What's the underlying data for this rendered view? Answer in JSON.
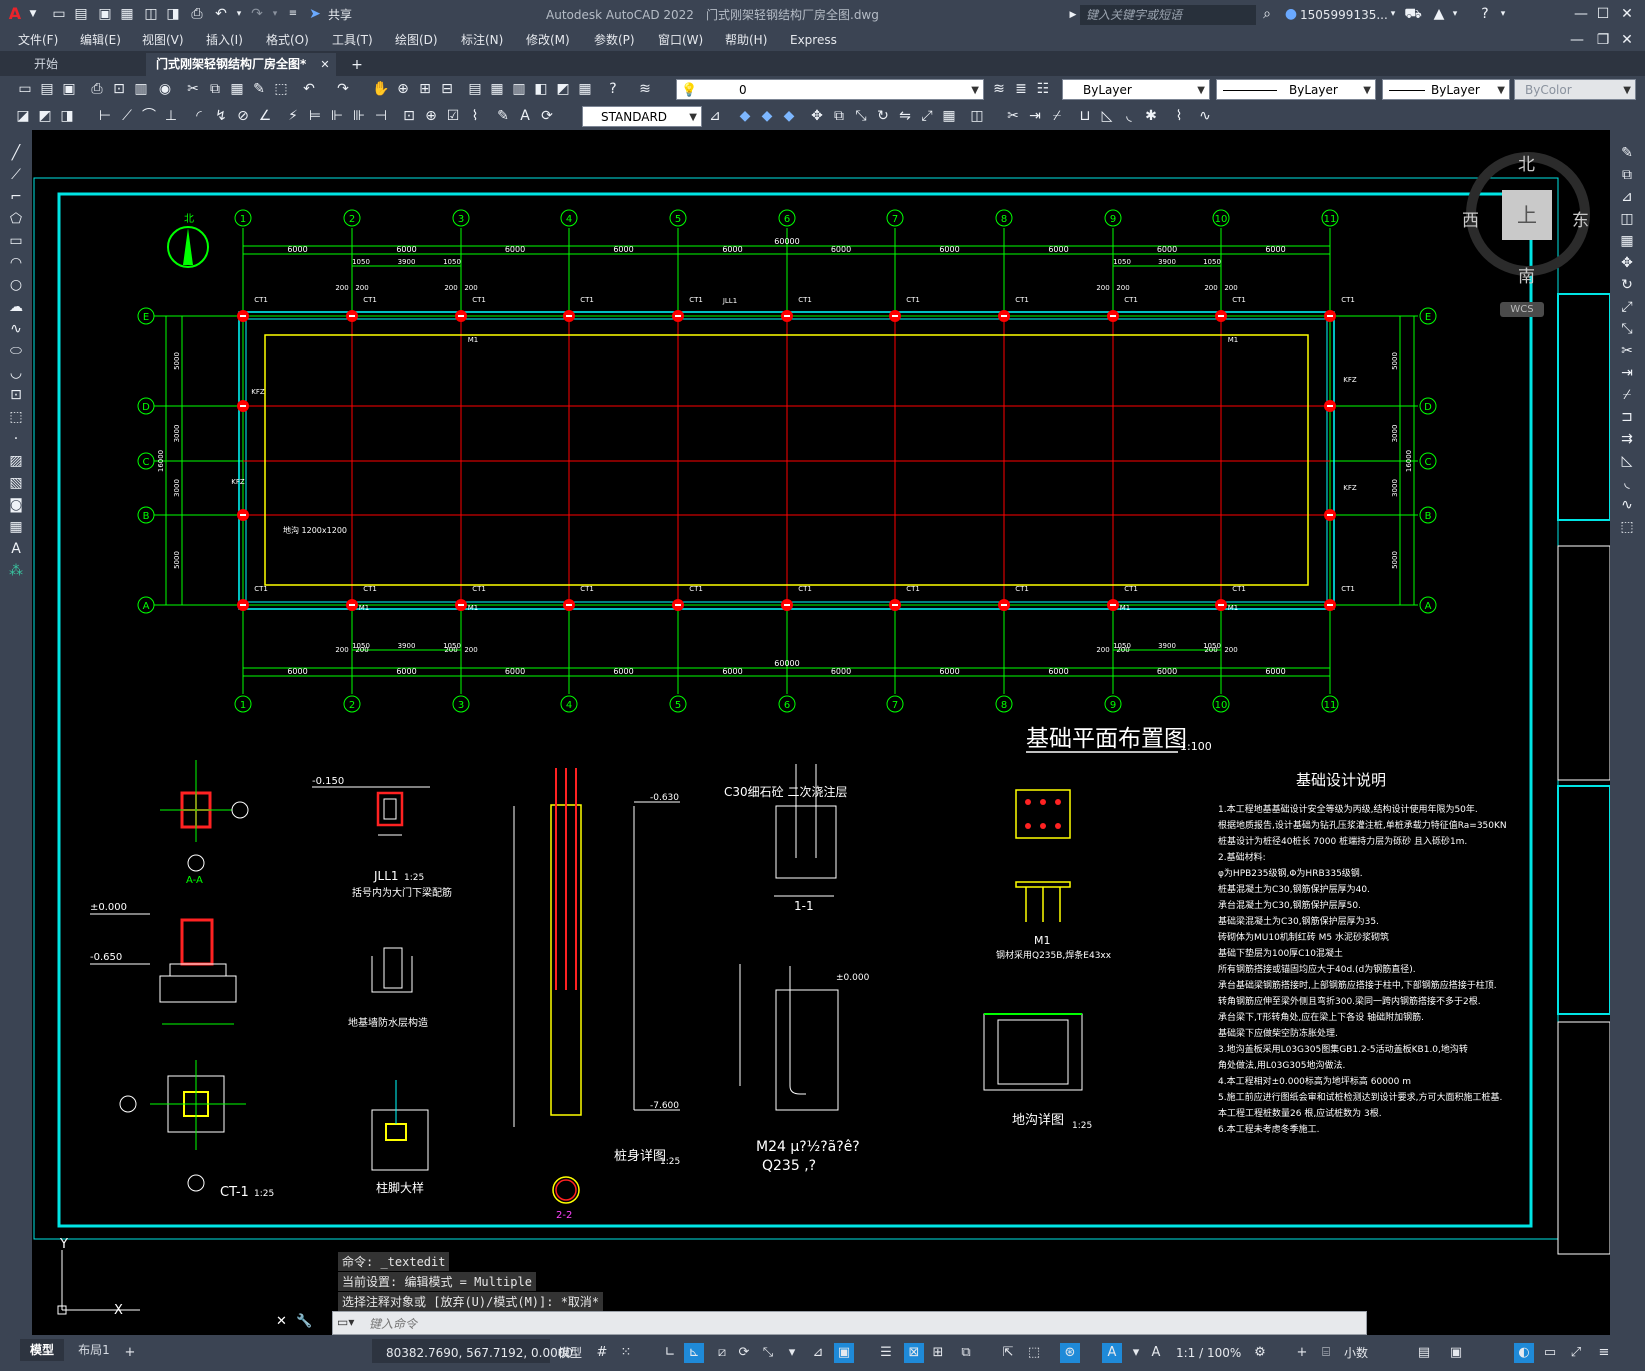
{
  "app": {
    "title": "Autodesk AutoCAD 2022",
    "filename": "门式刚架轻钢结构厂房全图.dwg",
    "search_placeholder": "键入关键字或短语",
    "user": "1505999135...",
    "share_label": "共享"
  },
  "menu": [
    "文件(F)",
    "编辑(E)",
    "视图(V)",
    "插入(I)",
    "格式(O)",
    "工具(T)",
    "绘图(D)",
    "标注(N)",
    "修改(M)",
    "参数(P)",
    "窗口(W)",
    "帮助(H)",
    "Express"
  ],
  "tabs": [
    {
      "label": "开始",
      "active": false
    },
    {
      "label": "门式刚架轻钢结构厂房全图*",
      "active": true
    }
  ],
  "toolbar": {
    "layer": "0",
    "text_style": "STANDARD",
    "color": "ByLayer",
    "linetype": "ByLayer",
    "lineweight": "ByLayer",
    "plotstyle": "ByColor"
  },
  "viewcube": {
    "north": "北",
    "south": "南",
    "east": "东",
    "west": "西",
    "top": "上",
    "wcs": "WCS"
  },
  "drawing": {
    "plan_title": "基础平面布置图",
    "plan_scale": "1:100",
    "notes_title": "基础设计说明",
    "notes": [
      "1.本工程地基基础设计安全等级为丙级,结构设计使用年限为50年.",
      "  根据地质报告,设计基础为钻孔压浆灌注桩,单桩承载力特征值Ra=350KN",
      "  桩基设计为桩径40桩长  7000  桩端持力层为砾砂 且入砾砂1m.",
      "2.基础材料:",
      "  φ为HPB235级钢,Φ为HRB335级钢.",
      "  桩基混凝土为C30,钢筋保护层厚为40.",
      "  承台混凝土为C30,钢筋保护层厚50.",
      "  基础梁混凝土为C30,钢筋保护层厚为35.",
      "  砖砌体为MU10机制红砖 M5 水泥砂浆砌筑",
      "  基础下垫层为100厚C10混凝土",
      "  所有钢筋搭接或锚固均应大于40d.(d为钢筋直径).",
      "  承台基础梁钢筋搭接时,上部钢筋应搭接于柱中,下部钢筋应搭接于柱顶.",
      "  转角钢筋应伸至梁外侧且弯折300.梁同一跨内钢筋搭接不多于2根.",
      "  承台梁下,T形转角处,应在梁上下各设  轴础附加钢筋.",
      "  基础梁下应做柴空防冻胀处理.",
      "3.地沟盖板采用L03G305图集GB1.2-5活动盖板KB1.0,地沟转",
      "  角处做法,用L03G305地沟做法.",
      "4.本工程相对±0.000标高为地坪标高       60000 m",
      "5.施工前应进行图纸会审和试桩检测达到设计要求,方可大面积施工桩基.",
      "  本工程工程桩数量26 根,应试桩数为 3根.",
      "6.本工程未考虑冬季施工."
    ],
    "dim_span": "6000",
    "dim_total": "60000",
    "dim_door": [
      "1050",
      "3900",
      "1050"
    ],
    "dim_200": "200",
    "dim_side": [
      "5000",
      "3000",
      "3000",
      "5000"
    ],
    "dim_depth": "16000",
    "grid_numbers": [
      "1",
      "2",
      "3",
      "4",
      "5",
      "6",
      "7",
      "8",
      "9",
      "10",
      "11"
    ],
    "grid_letters": [
      "E",
      "D",
      "C",
      "B",
      "A"
    ],
    "ditch_label": "地沟 1200x1200",
    "labels": {
      "north": "北",
      "ct1": "CT1",
      "kfz": "KFZ",
      "jll1_tag": "JLL1",
      "m1": "M1",
      "sec_aa": "A-A",
      "sec_jll1": "JLL1",
      "sec_jll1_scale": "1:25",
      "sec_jll1_note": "括号内为大门下梁配筋",
      "sec_wall": "地基墙防水层构造",
      "sec_ct1": "CT-1",
      "sec_ct1_scale": "1:25",
      "sec_col": "柱脚大样",
      "sec_pile": "桩身详图",
      "sec_pile_scale": "1:25",
      "sec_22": "2-2",
      "sec_11": "1-1",
      "sec_m24": "M24 μ?½?ã?ê?",
      "sec_q235": "Q235 ,?",
      "sec_ditch": "地沟详图",
      "sec_ditch_scale": "1:25",
      "sec_m1": "M1",
      "sec_m1_note": "钢材采用Q235B,焊条E43xx",
      "c30_fill": "C30细石砼 二次浇注层",
      "elev_0": "±0.000",
      "elev_650": "-0.650",
      "elev_150": "-0.150",
      "elev_630": "-0.630",
      "elev_7600": "-7.600"
    }
  },
  "command": {
    "history": [
      "命令: _textedit",
      "当前设置: 编辑模式 = Multiple",
      "选择注释对象或 [放弃(U)/模式(M)]: *取消*"
    ],
    "placeholder": "键入命令"
  },
  "status": {
    "tabs": [
      "模型",
      "布局1"
    ],
    "coords": "80382.7690, 567.7192, 0.0000",
    "mode": "模型",
    "scale": "1:1 / 100%",
    "units": "小数"
  },
  "colors": {
    "axis": "#00ff00",
    "column": "#ff0000",
    "beam": "#ff0000",
    "wall": "#00ffff",
    "ditch": "#ffff00",
    "text": "#ffffff",
    "frame": "#00e5e5"
  }
}
